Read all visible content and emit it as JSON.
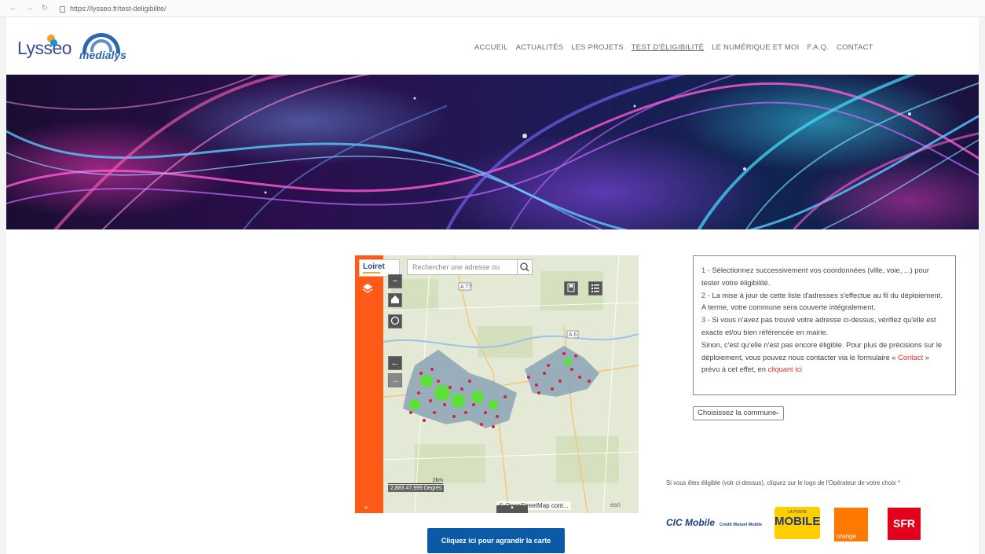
{
  "browser": {
    "url": "https://lysseo.fr/test-deligibilite/"
  },
  "header": {
    "logo_lysseo": "Lysseo",
    "logo_medialys": "medialys",
    "menu": [
      {
        "label": "ACCUEIL"
      },
      {
        "label": "ACTUALITÉS"
      },
      {
        "label": "LES PROJETS"
      },
      {
        "label": "TEST D'ÉLIGIBILITÉ",
        "active": true
      },
      {
        "label": "LE NUMÉRIQUE ET MOI"
      },
      {
        "label": "F.A.Q."
      },
      {
        "label": "CONTACT"
      }
    ]
  },
  "map": {
    "brand": "Loiret",
    "search_placeholder": "Rechercher une adresse ou",
    "road_a77": "A 77",
    "road_a6": "A 6",
    "scale_label": "2km",
    "coords": "2,883 47,999 Degrés",
    "attribution": "© OpenStreetMap cont...",
    "esri": "esri",
    "enlarge_button": "Cliquez ici pour agrandir la carte"
  },
  "info": {
    "step1_num": "1 -",
    "step1_text": " Sélectionnez successivement vos coordonnées (ville, voie, ...) pour tester votre éligibilité.",
    "step2_num": "2 -",
    "step2_text": " La mise à jour de cette liste d'adresses s'effectue au fil du déploiement. A terme, votre commune sera couverte intégralement.",
    "step3_num": "3 -",
    "step3_text": " Si vous n'avez pas trouvé votre adresse ci-dessus, vérifiez qu'elle est exacte et/ou bien référencée en mairie.",
    "para_text": "Sinon, c'est qu'elle n'est pas encore éligible. Pour plus de précisions sur le déploiement, vous pouvez nous contacter via le formulaire « ",
    "contact_link": "Contact",
    "para_text2": " » prévu à cet effet, en ",
    "click_link": "cliquant ici"
  },
  "select": {
    "value": "Choisissez la commune"
  },
  "operators": {
    "intro": "Si vous êtes éligible (voir ci-dessus), cliquez sur le logo de l'Opérateur de votre choix *",
    "cic": "CIC Mobile",
    "cic_sub": "Crédit Mutuel Mobile",
    "laposte_small": "LA POSTE",
    "laposte_big": "MOBILE",
    "orange": "orange",
    "sfr": "SFR"
  }
}
